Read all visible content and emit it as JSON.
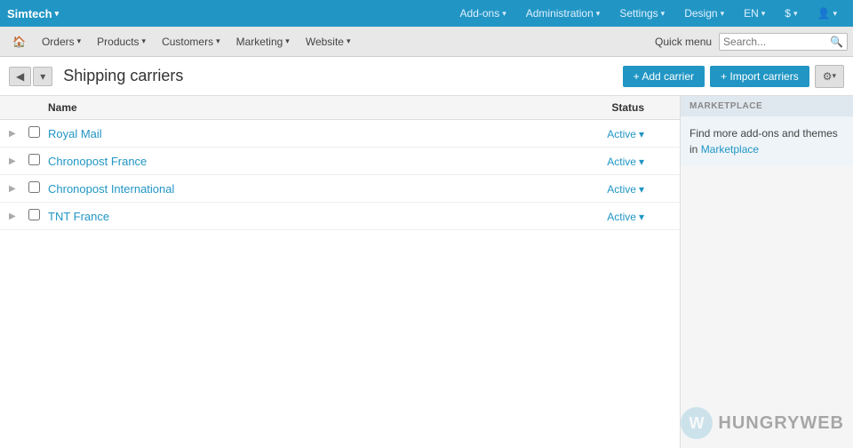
{
  "topbar": {
    "brand": "Simtech",
    "nav_items": [
      {
        "label": "Add-ons",
        "id": "addons"
      },
      {
        "label": "Administration",
        "id": "administration"
      },
      {
        "label": "Settings",
        "id": "settings"
      },
      {
        "label": "Design",
        "id": "design"
      },
      {
        "label": "EN",
        "id": "language"
      },
      {
        "label": "$",
        "id": "currency"
      },
      {
        "label": "👤",
        "id": "user"
      }
    ]
  },
  "secondbar": {
    "nav_items": [
      {
        "label": "🏠",
        "id": "home",
        "icon": true
      },
      {
        "label": "Orders",
        "id": "orders"
      },
      {
        "label": "Products",
        "id": "products"
      },
      {
        "label": "Customers",
        "id": "customers"
      },
      {
        "label": "Marketing",
        "id": "marketing"
      },
      {
        "label": "Website",
        "id": "website"
      }
    ],
    "quick_menu": "Quick menu",
    "search_placeholder": "Search..."
  },
  "page_header": {
    "title": "Shipping carriers",
    "back_label": "◀",
    "dropdown_label": "▾",
    "add_carrier_label": "+ Add carrier",
    "import_carriers_label": "+ Import carriers",
    "settings_label": "⚙"
  },
  "table": {
    "columns": [
      {
        "id": "name",
        "label": "Name"
      },
      {
        "id": "status",
        "label": "Status"
      }
    ],
    "rows": [
      {
        "id": 1,
        "name": "Royal Mail",
        "status": "Active"
      },
      {
        "id": 2,
        "name": "Chronopost France",
        "status": "Active"
      },
      {
        "id": 3,
        "name": "Chronopost International",
        "status": "Active"
      },
      {
        "id": 4,
        "name": "TNT France",
        "status": "Active"
      }
    ]
  },
  "sidebar": {
    "marketplace_header": "MARKETPLACE",
    "marketplace_text": "Find more add-ons and themes in",
    "marketplace_link": "Marketplace"
  },
  "watermark": {
    "logo": "W",
    "text": "HUNGRYWEB"
  }
}
